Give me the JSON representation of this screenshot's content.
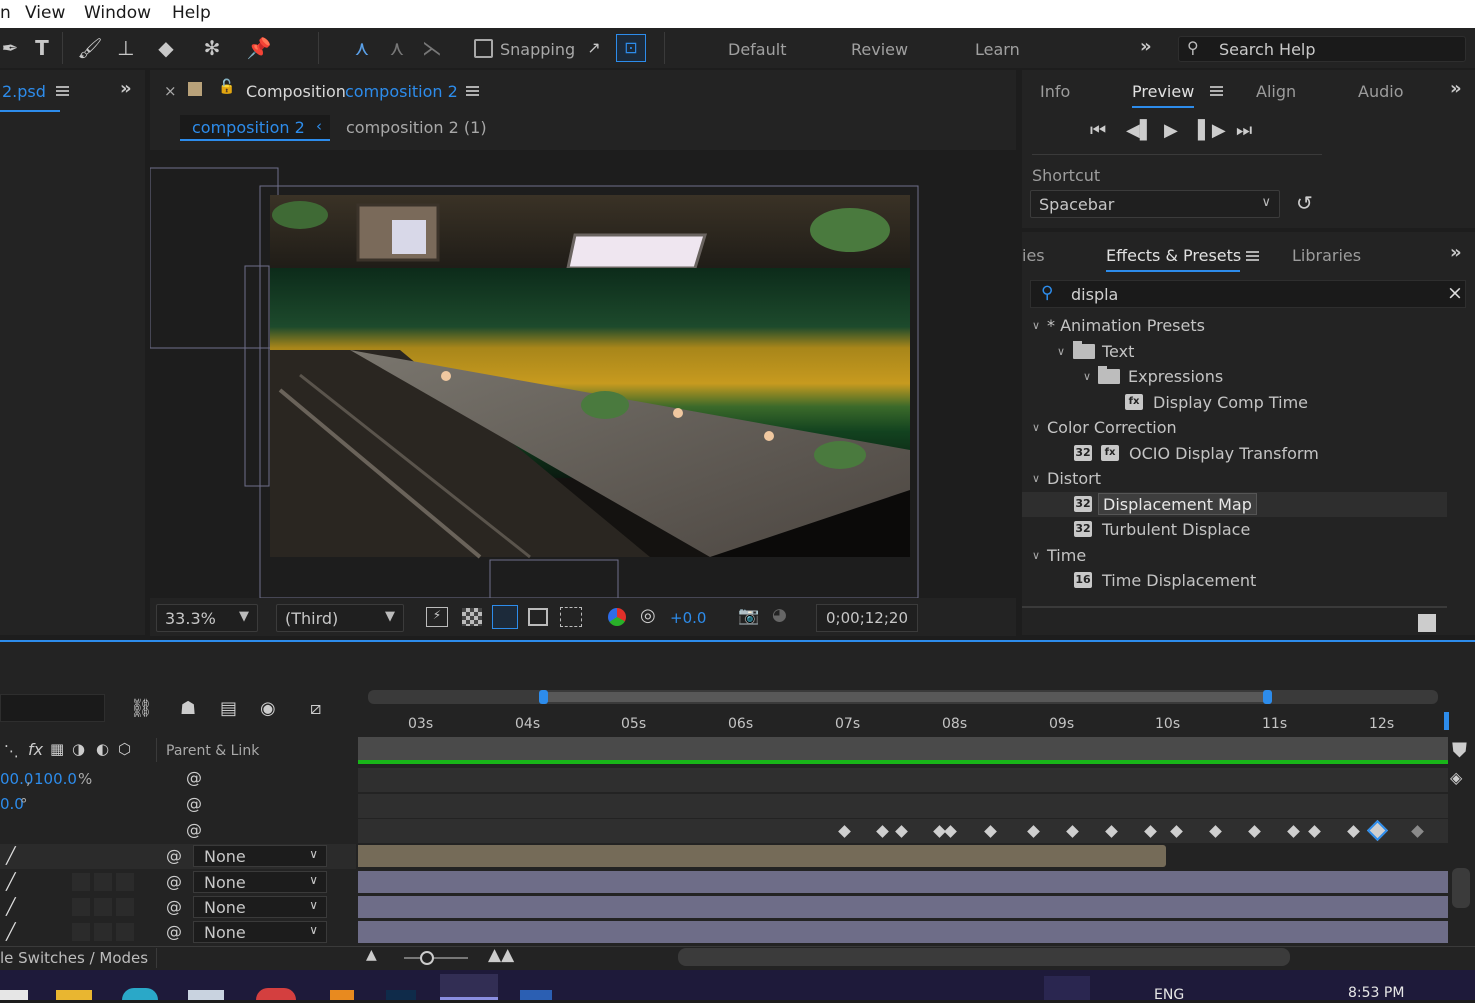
{
  "menu": {
    "items": [
      "n",
      "View",
      "Window",
      "Help"
    ]
  },
  "toolbar": {
    "snapping_label": "Snapping",
    "workspaces": [
      "Default",
      "Review",
      "Learn"
    ],
    "search_placeholder": "Search Help"
  },
  "project_panel": {
    "tab_label": "2.psd"
  },
  "composition_panel": {
    "title_prefix": "Composition",
    "comp_name": "composition 2",
    "flow_active": "composition 2",
    "flow_other": "composition 2 (1)",
    "zoom": "33.3%",
    "resolution": "(Third)",
    "exposure": "+0.0",
    "timecode": "0;00;12;20"
  },
  "right_top": {
    "tabs": [
      "Info",
      "Preview",
      "Align",
      "Audio"
    ],
    "active_tab": "Preview",
    "shortcut_label": "Shortcut",
    "shortcut_value": "Spacebar"
  },
  "effects_panel": {
    "tabs": [
      "ies",
      "Effects & Presets",
      "Libraries"
    ],
    "search_value": "displa",
    "tree": [
      {
        "label": "* Animation Presets",
        "type": "group"
      },
      {
        "label": "Text",
        "type": "folder"
      },
      {
        "label": "Expressions",
        "type": "folder"
      },
      {
        "label": "Display Comp Time",
        "type": "preset"
      },
      {
        "label": "Color Correction",
        "type": "group"
      },
      {
        "label": "OCIO Display Transform",
        "type": "effect"
      },
      {
        "label": "Distort",
        "type": "group"
      },
      {
        "label": "Displacement Map",
        "type": "effect",
        "selected": true
      },
      {
        "label": "Turbulent Displace",
        "type": "effect"
      },
      {
        "label": "Time",
        "type": "group"
      },
      {
        "label": "Time Displacement",
        "type": "effect"
      }
    ],
    "badges": {
      "b32": "32",
      "b16": "16"
    }
  },
  "timeline": {
    "ticks": [
      "03s",
      "04s",
      "05s",
      "06s",
      "07s",
      "08s",
      "09s",
      "10s",
      "11s",
      "12s"
    ],
    "parent_link_label": "Parent & Link",
    "scale_value_a": "00.0",
    "scale_value_b": "100.0",
    "scale_unit": "%",
    "rotation_value": "0.0",
    "rotation_unit": "°",
    "parent_options": [
      "None",
      "None",
      "None",
      "None"
    ],
    "bottom_label": "le Switches / Modes"
  },
  "taskbar": {
    "lang": "ENG",
    "time": "8:53 PM"
  },
  "colors": {
    "accent": "#2d8ceb",
    "keyframe": "#cfcfcf",
    "track_green": "#19b519",
    "bar_tan": "#756b58",
    "bar_purple": "#6e6d88"
  }
}
